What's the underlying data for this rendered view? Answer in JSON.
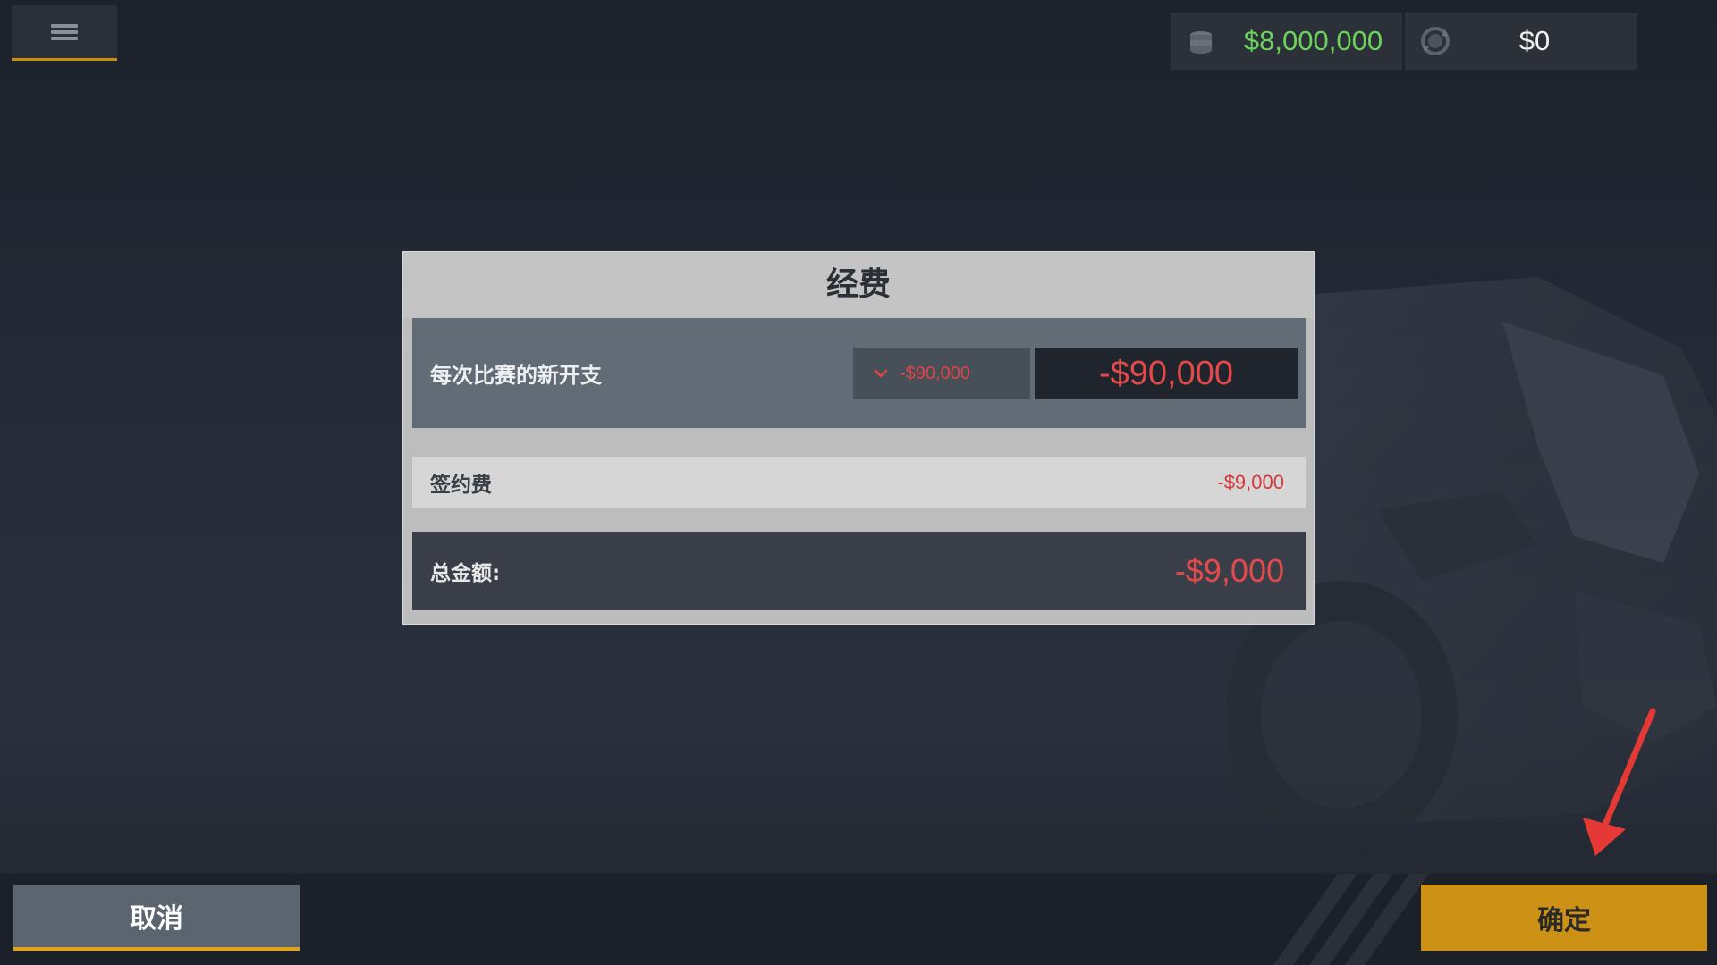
{
  "topbar": {
    "menu_icon": "hamburger-menu-icon",
    "cash": {
      "icon": "coin-stack-icon",
      "value": "$8,000,000",
      "color": "#6bd35a"
    },
    "gold": {
      "icon": "refresh-coin-icon",
      "value": "$0"
    }
  },
  "dialog": {
    "title": "经费",
    "new_cost_row": {
      "label": "每次比赛的新开支",
      "dropdown_value": "-$90,000",
      "dropdown_icon": "chevron-down-icon",
      "display_value": "-$90,000"
    },
    "signing_row": {
      "label": "签约费",
      "value": "-$9,000"
    },
    "total_row": {
      "label": "总金额:",
      "value": "-$9,000"
    }
  },
  "footer": {
    "cancel_label": "取消",
    "confirm_label": "确定"
  },
  "colors": {
    "accent": "#cc9115",
    "negative": "#e04545",
    "annotation": "#e53935"
  }
}
